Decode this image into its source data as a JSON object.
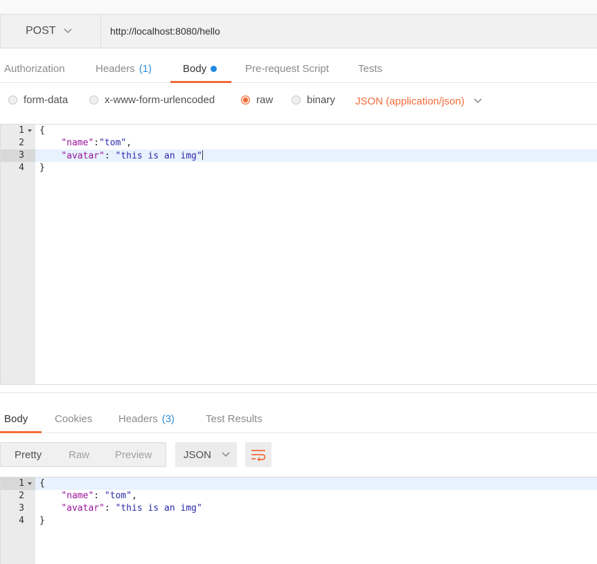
{
  "request": {
    "method": "POST",
    "url": "http://localhost:8080/hello",
    "tabs": [
      {
        "label": "Authorization"
      },
      {
        "label": "Headers",
        "count": "(1)"
      },
      {
        "label": "Body"
      },
      {
        "label": "Pre-request Script"
      },
      {
        "label": "Tests"
      }
    ],
    "body_types": [
      "form-data",
      "x-www-form-urlencoded",
      "raw",
      "binary"
    ],
    "selected_body_type": "raw",
    "content_type": "JSON (application/json)",
    "editor": {
      "line_numbers": [
        "1",
        "2",
        "3",
        "4"
      ],
      "lines": {
        "l1": "{",
        "l2_key": "\"name\"",
        "l2_sep": ":",
        "l2_val": "\"tom\"",
        "l2_end": ",",
        "l3_key": "\"avatar\"",
        "l3_sep": ": ",
        "l3_val": "\"this is an img\"",
        "l4": "}"
      }
    }
  },
  "response": {
    "tabs": [
      {
        "label": "Body"
      },
      {
        "label": "Cookies"
      },
      {
        "label": "Headers",
        "count": "(3)"
      },
      {
        "label": "Test Results"
      }
    ],
    "view_modes": [
      "Pretty",
      "Raw",
      "Preview"
    ],
    "format": "JSON",
    "editor": {
      "line_numbers": [
        "1",
        "2",
        "3",
        "4"
      ],
      "lines": {
        "l1": "{",
        "l2_key": "\"name\"",
        "l2_sep": ": ",
        "l2_val": "\"tom\"",
        "l2_end": ",",
        "l3_key": "\"avatar\"",
        "l3_sep": ": ",
        "l3_val": "\"this is an img\"",
        "l4": "}"
      }
    }
  },
  "colors": {
    "accent": "#f26b3a",
    "count_blue": "#2f8dd9",
    "dot_blue": "#1e88e5",
    "json_key": "#991199",
    "json_string": "#2a2aa8"
  }
}
